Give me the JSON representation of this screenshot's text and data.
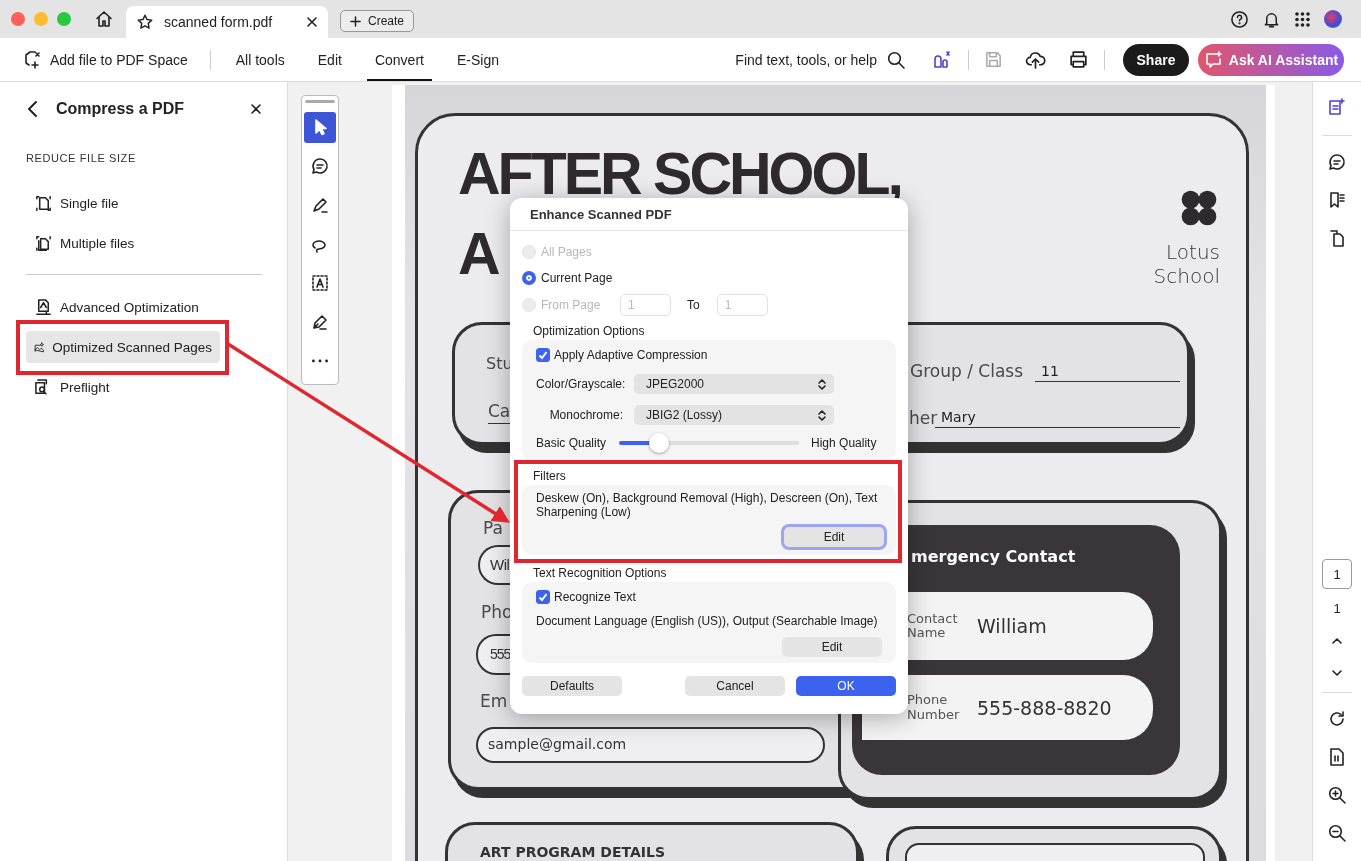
{
  "window": {
    "tab_title": "scanned form.pdf",
    "create": "Create"
  },
  "toolbar": {
    "add_file": "Add file to PDF Space",
    "menu": [
      {
        "label": "All tools",
        "selected": false
      },
      {
        "label": "Edit",
        "selected": false
      },
      {
        "label": "Convert",
        "selected": true
      },
      {
        "label": "E-Sign",
        "selected": false
      }
    ],
    "search": "Find text, tools, or help",
    "share": "Share",
    "ai": "Ask AI Assistant"
  },
  "sidebar": {
    "title": "Compress a PDF",
    "section": "REDUCE FILE SIZE",
    "groups": [
      [
        {
          "kind": "single",
          "label": "Single file",
          "selected": false
        },
        {
          "kind": "multiple",
          "label": "Multiple files",
          "selected": false
        }
      ],
      [
        {
          "kind": "advanced",
          "label": "Advanced Optimization",
          "selected": false
        },
        {
          "kind": "scanned",
          "label": "Optimized Scanned Pages",
          "selected": true
        },
        {
          "kind": "preflight",
          "label": "Preflight",
          "selected": false
        }
      ]
    ]
  },
  "tools": [
    {
      "kind": "select",
      "selected": true
    },
    {
      "kind": "comment",
      "selected": false
    },
    {
      "kind": "highlight",
      "selected": false
    },
    {
      "kind": "draw",
      "selected": false
    },
    {
      "kind": "text",
      "selected": false
    },
    {
      "kind": "sign",
      "selected": false
    },
    {
      "kind": "more",
      "selected": false
    }
  ],
  "document": {
    "title": [
      "AFTER SCHOOL,",
      "A"
    ],
    "school": "Lotus School",
    "student_labels": [
      "Stu",
      "Ca"
    ],
    "group_label": "Group / Class",
    "group_value": "11",
    "teacher_label": "her",
    "teacher_value": "Mary",
    "contact_labels": [
      "Pa",
      "Pho",
      "Em"
    ],
    "contact_values": [
      "Wil",
      "555",
      "sample@gmail.com"
    ],
    "emergency_title": "mergency Contact",
    "emergency_rows": [
      {
        "label": "Contact Name",
        "value": "William"
      },
      {
        "label": "Phone Number",
        "value": "555-888-8820"
      }
    ],
    "section": "ART PROGRAM DETAILS"
  },
  "page_nav": {
    "current": "1",
    "total": "1"
  },
  "dialog": {
    "title": "Enhance Scanned PDF",
    "range": [
      {
        "label": "All Pages",
        "selected": false,
        "disabled": true
      },
      {
        "label": "Current Page",
        "selected": true,
        "disabled": false
      },
      {
        "label": "From Page",
        "selected": false,
        "disabled": true
      }
    ],
    "from_value": "1",
    "to_label": "To",
    "to_value": "1",
    "optimization": {
      "title": "Optimization Options",
      "adaptive": {
        "label": "Apply Adaptive Compression",
        "checked": true
      },
      "selects": [
        {
          "label": "Color/Grayscale:",
          "value": "JPEG2000"
        },
        {
          "label": "Monochrome:",
          "value": "JBIG2 (Lossy)"
        }
      ],
      "quality": {
        "min_label": "Basic Quality",
        "max_label": "High Quality",
        "level": 0.22
      }
    },
    "filters": {
      "title": "Filters",
      "summary": "Deskew (On), Background Removal (High), Descreen (On), Text Sharpening (Low)",
      "edit": "Edit"
    },
    "text_recognition": {
      "title": "Text Recognition Options",
      "recognize": {
        "label": "Recognize Text",
        "checked": true
      },
      "summary": "Document Language (English (US)), Output (Searchable Image)",
      "edit": "Edit"
    },
    "buttons": {
      "defaults": "Defaults",
      "cancel": "Cancel",
      "ok": "OK"
    }
  }
}
